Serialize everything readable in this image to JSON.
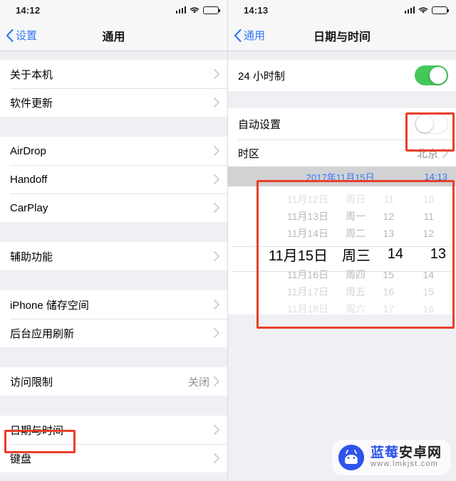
{
  "left": {
    "status": {
      "time": "14:12",
      "signal_icon": "cellular-bars-icon",
      "wifi_icon": "wifi-icon",
      "battery_icon": "battery-icon"
    },
    "nav": {
      "back_label": "设置",
      "title": "通用"
    },
    "sections": [
      {
        "rows": [
          {
            "label": "关于本机",
            "value": "",
            "chevron": true
          },
          {
            "label": "软件更新",
            "value": "",
            "chevron": true
          }
        ]
      },
      {
        "rows": [
          {
            "label": "AirDrop",
            "value": "",
            "chevron": true
          },
          {
            "label": "Handoff",
            "value": "",
            "chevron": true
          },
          {
            "label": "CarPlay",
            "value": "",
            "chevron": true
          }
        ]
      },
      {
        "rows": [
          {
            "label": "辅助功能",
            "value": "",
            "chevron": true
          }
        ]
      },
      {
        "rows": [
          {
            "label": "iPhone 储存空间",
            "value": "",
            "chevron": true
          },
          {
            "label": "后台应用刷新",
            "value": "",
            "chevron": true
          }
        ]
      },
      {
        "rows": [
          {
            "label": "访问限制",
            "value": "关闭",
            "chevron": true
          }
        ]
      },
      {
        "rows": [
          {
            "label": "日期与时间",
            "value": "",
            "chevron": true,
            "highlight": true
          },
          {
            "label": "键盘",
            "value": "",
            "chevron": true
          }
        ]
      }
    ]
  },
  "right": {
    "status": {
      "time": "14:13",
      "signal_icon": "cellular-bars-icon",
      "wifi_icon": "wifi-icon",
      "battery_icon": "battery-icon"
    },
    "nav": {
      "back_label": "通用",
      "title": "日期与时间"
    },
    "rows": {
      "hour24_label": "24 小时制",
      "hour24_state": "on",
      "auto_label": "自动设置",
      "auto_state": "off",
      "timezone_label": "时区",
      "timezone_value": "北京"
    },
    "picker": {
      "header_date": "2017年11月15日",
      "header_time": "14:13",
      "rows": [
        {
          "date": "11月12日",
          "day": "周日",
          "hour": "11",
          "minute": "10",
          "state": "faint"
        },
        {
          "date": "11月13日",
          "day": "周一",
          "hour": "12",
          "minute": "11",
          "state": "dim"
        },
        {
          "date": "11月14日",
          "day": "周二",
          "hour": "13",
          "minute": "12",
          "state": "dim"
        },
        {
          "date": "11月15日",
          "day": "周三",
          "hour": "14",
          "minute": "13",
          "state": "selected"
        },
        {
          "date": "11月16日",
          "day": "周四",
          "hour": "15",
          "minute": "14",
          "state": "dim"
        },
        {
          "date": "11月17日",
          "day": "周五",
          "hour": "16",
          "minute": "15",
          "state": "dim"
        },
        {
          "date": "11月18日",
          "day": "周六",
          "hour": "17",
          "minute": "16",
          "state": "faint"
        }
      ]
    }
  },
  "watermark": {
    "name_blue": "蓝莓",
    "name_dark": "安卓网",
    "url": "www.lmkjst.com",
    "icon": "android-robot-icon"
  },
  "colors": {
    "accent_blue": "#3478f6",
    "toggle_on_green": "#45c85a",
    "annotation_red": "#e8402a",
    "list_bg": "#efeff4",
    "row_bg": "#ffffff",
    "secondary_text": "#8e8e93"
  }
}
